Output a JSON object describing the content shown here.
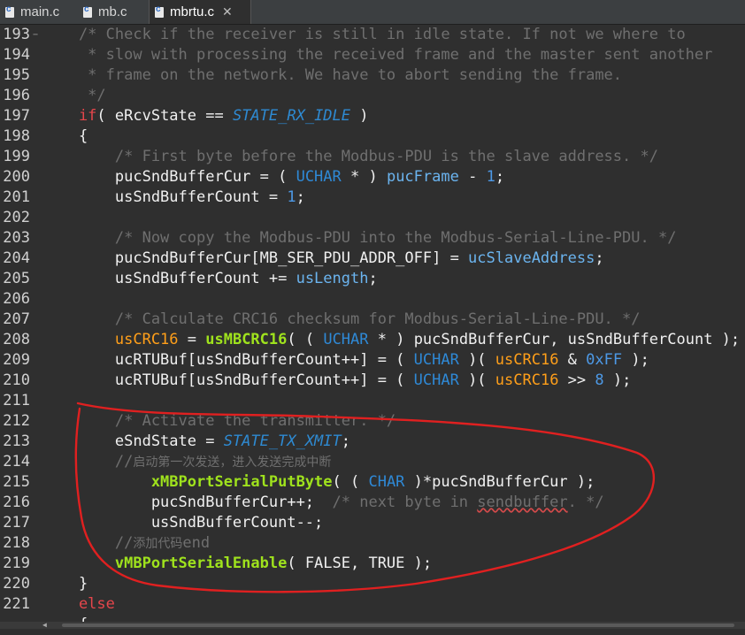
{
  "tabs": [
    {
      "label": "main.c",
      "active": false
    },
    {
      "label": "mb.c",
      "active": false
    },
    {
      "label": "mbrtu.c",
      "active": true,
      "close": "✕"
    }
  ],
  "editor": {
    "gutter_fold_marker": "−",
    "lines": [
      {
        "n": "193",
        "tokens": [
          [
            "cmt",
            "    /* Check if the receiver is still in idle state. If not we where to"
          ]
        ]
      },
      {
        "n": "194",
        "tokens": [
          [
            "cmt",
            "     * slow with processing the received frame and the master sent another"
          ]
        ]
      },
      {
        "n": "195",
        "tokens": [
          [
            "cmt",
            "     * frame on the network. We have to abort sending the frame."
          ]
        ]
      },
      {
        "n": "196",
        "tokens": [
          [
            "cmt",
            "     */"
          ]
        ]
      },
      {
        "n": "197",
        "tokens": [
          [
            "kw",
            "    if"
          ],
          [
            "pln",
            "( eRcvState == "
          ],
          [
            "const",
            "STATE_RX_IDLE"
          ],
          [
            "pln",
            " )"
          ]
        ]
      },
      {
        "n": "198",
        "tokens": [
          [
            "pln",
            "    {"
          ]
        ]
      },
      {
        "n": "199",
        "tokens": [
          [
            "cmt",
            "        /* First byte before the Modbus-PDU is the slave address. */"
          ]
        ]
      },
      {
        "n": "200",
        "tokens": [
          [
            "pln",
            "        pucSndBufferCur = ( "
          ],
          [
            "typ",
            "UCHAR"
          ],
          [
            "pln",
            " * ) "
          ],
          [
            "gl",
            "pucFrame"
          ],
          [
            "pln",
            " - "
          ],
          [
            "num",
            "1"
          ],
          [
            "pln",
            ";"
          ]
        ]
      },
      {
        "n": "201",
        "tokens": [
          [
            "pln",
            "        usSndBufferCount = "
          ],
          [
            "num",
            "1"
          ],
          [
            "pln",
            ";"
          ]
        ]
      },
      {
        "n": "202",
        "tokens": [
          [
            "pln",
            ""
          ]
        ]
      },
      {
        "n": "203",
        "tokens": [
          [
            "cmt",
            "        /* Now copy the Modbus-PDU into the Modbus-Serial-Line-PDU. */"
          ]
        ]
      },
      {
        "n": "204",
        "tokens": [
          [
            "pln",
            "        pucSndBufferCur[MB_SER_PDU_ADDR_OFF] = "
          ],
          [
            "gl",
            "ucSlaveAddress"
          ],
          [
            "pln",
            ";"
          ]
        ]
      },
      {
        "n": "205",
        "tokens": [
          [
            "pln",
            "        usSndBufferCount += "
          ],
          [
            "gl",
            "usLength"
          ],
          [
            "pln",
            ";"
          ]
        ]
      },
      {
        "n": "206",
        "tokens": [
          [
            "pln",
            ""
          ]
        ]
      },
      {
        "n": "207",
        "tokens": [
          [
            "cmt",
            "        /* Calculate CRC16 checksum for Modbus-Serial-Line-PDU. */"
          ]
        ]
      },
      {
        "n": "208",
        "tokens": [
          [
            "org",
            "        usCRC16"
          ],
          [
            "pln",
            " = "
          ],
          [
            "fn",
            "usMBCRC16"
          ],
          [
            "pln",
            "( ( "
          ],
          [
            "typ",
            "UCHAR"
          ],
          [
            "pln",
            " * ) pucSndBufferCur, usSndBufferCount );"
          ]
        ]
      },
      {
        "n": "209",
        "tokens": [
          [
            "pln",
            "        ucRTUBuf[usSndBufferCount++] = ( "
          ],
          [
            "typ",
            "UCHAR"
          ],
          [
            "pln",
            " )( "
          ],
          [
            "org",
            "usCRC16"
          ],
          [
            "pln",
            " & "
          ],
          [
            "num",
            "0xFF"
          ],
          [
            "pln",
            " );"
          ]
        ]
      },
      {
        "n": "210",
        "tokens": [
          [
            "pln",
            "        ucRTUBuf[usSndBufferCount++] = ( "
          ],
          [
            "typ",
            "UCHAR"
          ],
          [
            "pln",
            " )( "
          ],
          [
            "org",
            "usCRC16"
          ],
          [
            "pln",
            " >> "
          ],
          [
            "num",
            "8"
          ],
          [
            "pln",
            " );"
          ]
        ]
      },
      {
        "n": "211",
        "tokens": [
          [
            "pln",
            ""
          ]
        ]
      },
      {
        "n": "212",
        "tokens": [
          [
            "cmt",
            "        /* Activate the transmitter. */"
          ]
        ]
      },
      {
        "n": "213",
        "tokens": [
          [
            "pln",
            "        eSndState = "
          ],
          [
            "const",
            "STATE_TX_XMIT"
          ],
          [
            "pln",
            ";"
          ]
        ]
      },
      {
        "n": "214",
        "tokens": [
          [
            "cmt",
            "        //"
          ],
          [
            "cmt cjk",
            "启动第一次发送，进入发送完成中断"
          ]
        ]
      },
      {
        "n": "215",
        "tokens": [
          [
            "fn",
            "            xMBPortSerialPutByte"
          ],
          [
            "pln",
            "( ( "
          ],
          [
            "typ",
            "CHAR"
          ],
          [
            "pln",
            " )*pucSndBufferCur );"
          ]
        ]
      },
      {
        "n": "216",
        "tokens": [
          [
            "pln",
            "            pucSndBufferCur++;  "
          ],
          [
            "cmt",
            "/* next byte in "
          ],
          [
            "cmt sq",
            "sendbuffer"
          ],
          [
            "cmt",
            ". */"
          ]
        ]
      },
      {
        "n": "217",
        "tokens": [
          [
            "pln",
            "            usSndBufferCount--;"
          ]
        ]
      },
      {
        "n": "218",
        "tokens": [
          [
            "cmt",
            "        //"
          ],
          [
            "cmt cjk",
            "添加代码"
          ],
          [
            "cmt",
            "end"
          ]
        ]
      },
      {
        "n": "219",
        "tokens": [
          [
            "fn",
            "        vMBPortSerialEnable"
          ],
          [
            "pln",
            "( FALSE, TRUE );"
          ]
        ]
      },
      {
        "n": "220",
        "tokens": [
          [
            "pln",
            "    }"
          ]
        ]
      },
      {
        "n": "221",
        "tokens": [
          [
            "kw",
            "    else"
          ]
        ]
      },
      {
        "n": "",
        "tokens": [
          [
            "pln",
            "    {"
          ]
        ]
      }
    ]
  },
  "colors": {
    "background": "#2f2f2f",
    "comment": "#6f6f6f",
    "keyword": "#e5464b",
    "function": "#9fe21d",
    "constant": "#2e8ad2",
    "annotation_circle": "#e02020"
  }
}
